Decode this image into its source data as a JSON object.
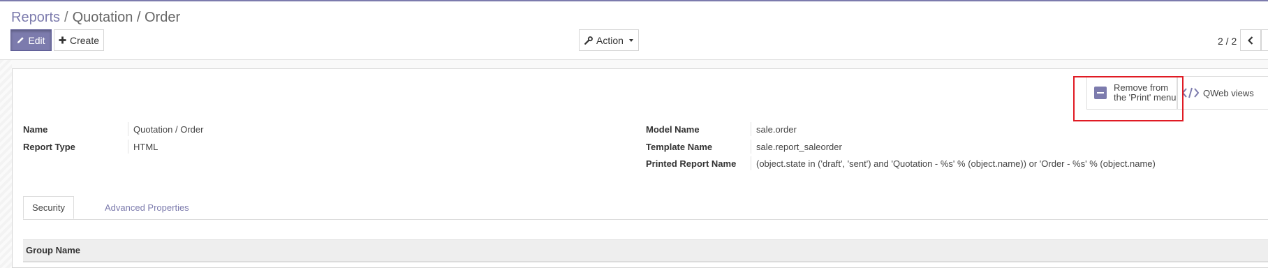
{
  "breadcrumb": {
    "root": "Reports",
    "separator": "/",
    "current": "Quotation / Order"
  },
  "buttons": {
    "edit": "Edit",
    "create": "Create",
    "action": "Action"
  },
  "pager": {
    "value": "2 / 2"
  },
  "stat_buttons": {
    "remove_line1": "Remove from",
    "remove_line2": "the 'Print' menu",
    "qweb": "QWeb views"
  },
  "fields": {
    "name_label": "Name",
    "name_value": "Quotation / Order",
    "report_type_label": "Report Type",
    "report_type_value": "HTML",
    "model_label": "Model Name",
    "model_value": "sale.order",
    "template_label": "Template Name",
    "template_value": "sale.report_saleorder",
    "printed_label": "Printed Report Name",
    "printed_value": "(object.state in ('draft', 'sent') and 'Quotation - %s' % (object.name)) or 'Order - %s' % (object.name)"
  },
  "tabs": {
    "security": "Security",
    "advanced": "Advanced Properties"
  },
  "table": {
    "group_name_header": "Group Name"
  },
  "colors": {
    "accent": "#7c7bad",
    "highlight": "#e01b24"
  }
}
